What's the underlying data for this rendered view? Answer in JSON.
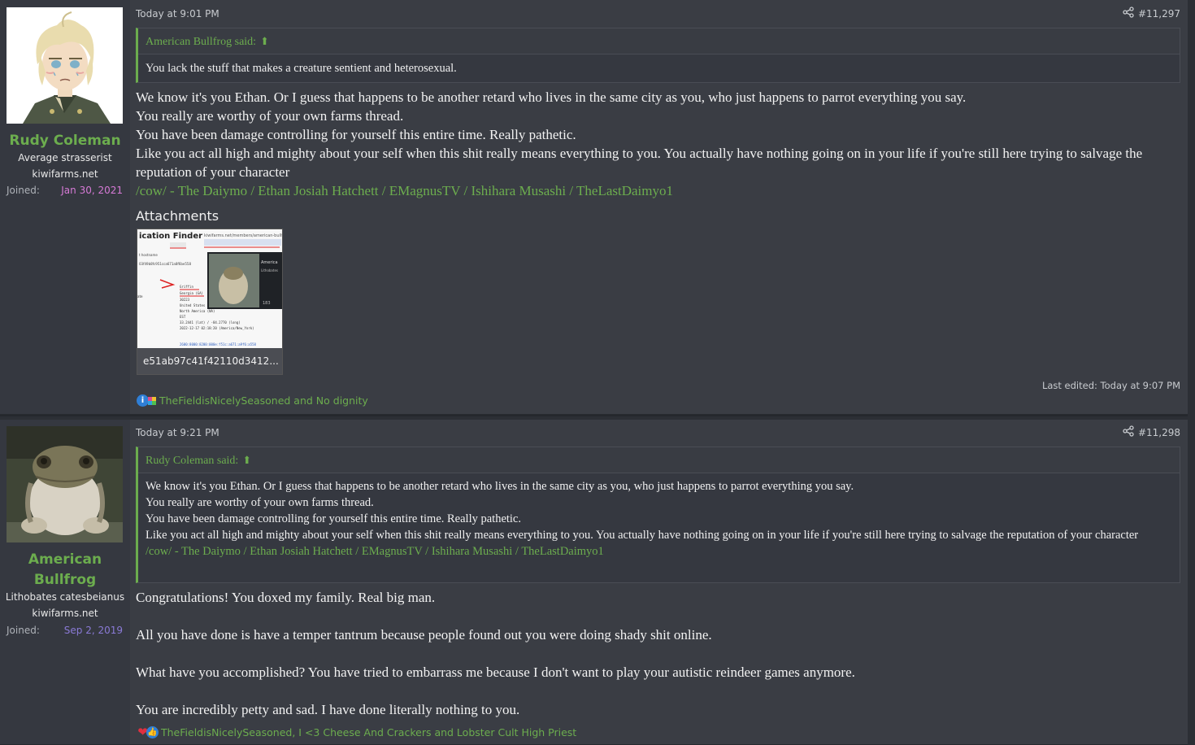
{
  "posts": [
    {
      "author": {
        "name": "Rudy Coleman",
        "title": "Average strasserist",
        "site": "kiwifarms.net",
        "joined_label": "Joined:",
        "joined_date": "Jan 30, 2021",
        "joined_color": "#d67ad6"
      },
      "timestamp": "Today at 9:01 PM",
      "post_number": "#11,297",
      "quote": {
        "author_line": "American Bullfrog said:",
        "lines": [
          "You lack the stuff that makes a creature sentient and heterosexual."
        ]
      },
      "body_lines": [
        "We know it's you Ethan. Or I guess that happens to be another retard who lives in the same city as you, who just happens to parrot everything you say.",
        "You really are worthy of your own farms thread.",
        "You have been damage controlling for yourself this entire time. Really pathetic.",
        "Like you act all high and mighty about your self when this shit really means everything to you. You actually have nothing going on in your life if you're still here trying to salvage the reputation of your character"
      ],
      "thread_link": "/cow/ - The Daiymo / Ethan Josiah Hatchett / EMagnusTV / Ishihara Musashi / TheLastDaimyo1",
      "attachments_label": "Attachments",
      "attachment_name": "e51ab97c41f42110d3412...",
      "last_edited": "Last edited: Today at 9:07 PM",
      "reactions": "TheFieldisNicelySeasoned and No dignity"
    },
    {
      "author": {
        "name_line1": "American",
        "name_line2": "Bullfrog",
        "title": "Lithobates catesbeianus",
        "site": "kiwifarms.net",
        "joined_label": "Joined:",
        "joined_date": "Sep 2, 2019",
        "joined_color": "#8a7ad6"
      },
      "timestamp": "Today at 9:21 PM",
      "post_number": "#11,298",
      "quote": {
        "author_line": "Rudy Coleman said:",
        "lines": [
          "We know it's you Ethan. Or I guess that happens to be another retard who lives in the same city as you, who just happens to parrot everything you say.",
          "You really are worthy of your own farms thread.",
          "You have been damage controlling for yourself this entire time. Really pathetic.",
          "Like you act all high and mighty about your self when this shit really means everything to you. You actually have nothing going on in your life if you're still here trying to salvage the reputation of your character"
        ],
        "link": "/cow/ - The Daiymo / Ethan Josiah Hatchett / EMagnusTV / Ishihara Musashi / TheLastDaimyo1"
      },
      "body_paragraphs": [
        "Congratulations! You doxed my family. Real big man.",
        "All you have done is have a temper tantrum because people found out you were doing shady shit online.",
        "What have you accomplished? You have tried to embarrass me because I don't want to play your autistic reindeer games anymore.",
        "You are incredibly petty and sad. I have done literally nothing to you."
      ],
      "reactions": "TheFieldisNicelySeasoned, I <3 Cheese And Crackers and Lobster Cult High Priest"
    }
  ]
}
